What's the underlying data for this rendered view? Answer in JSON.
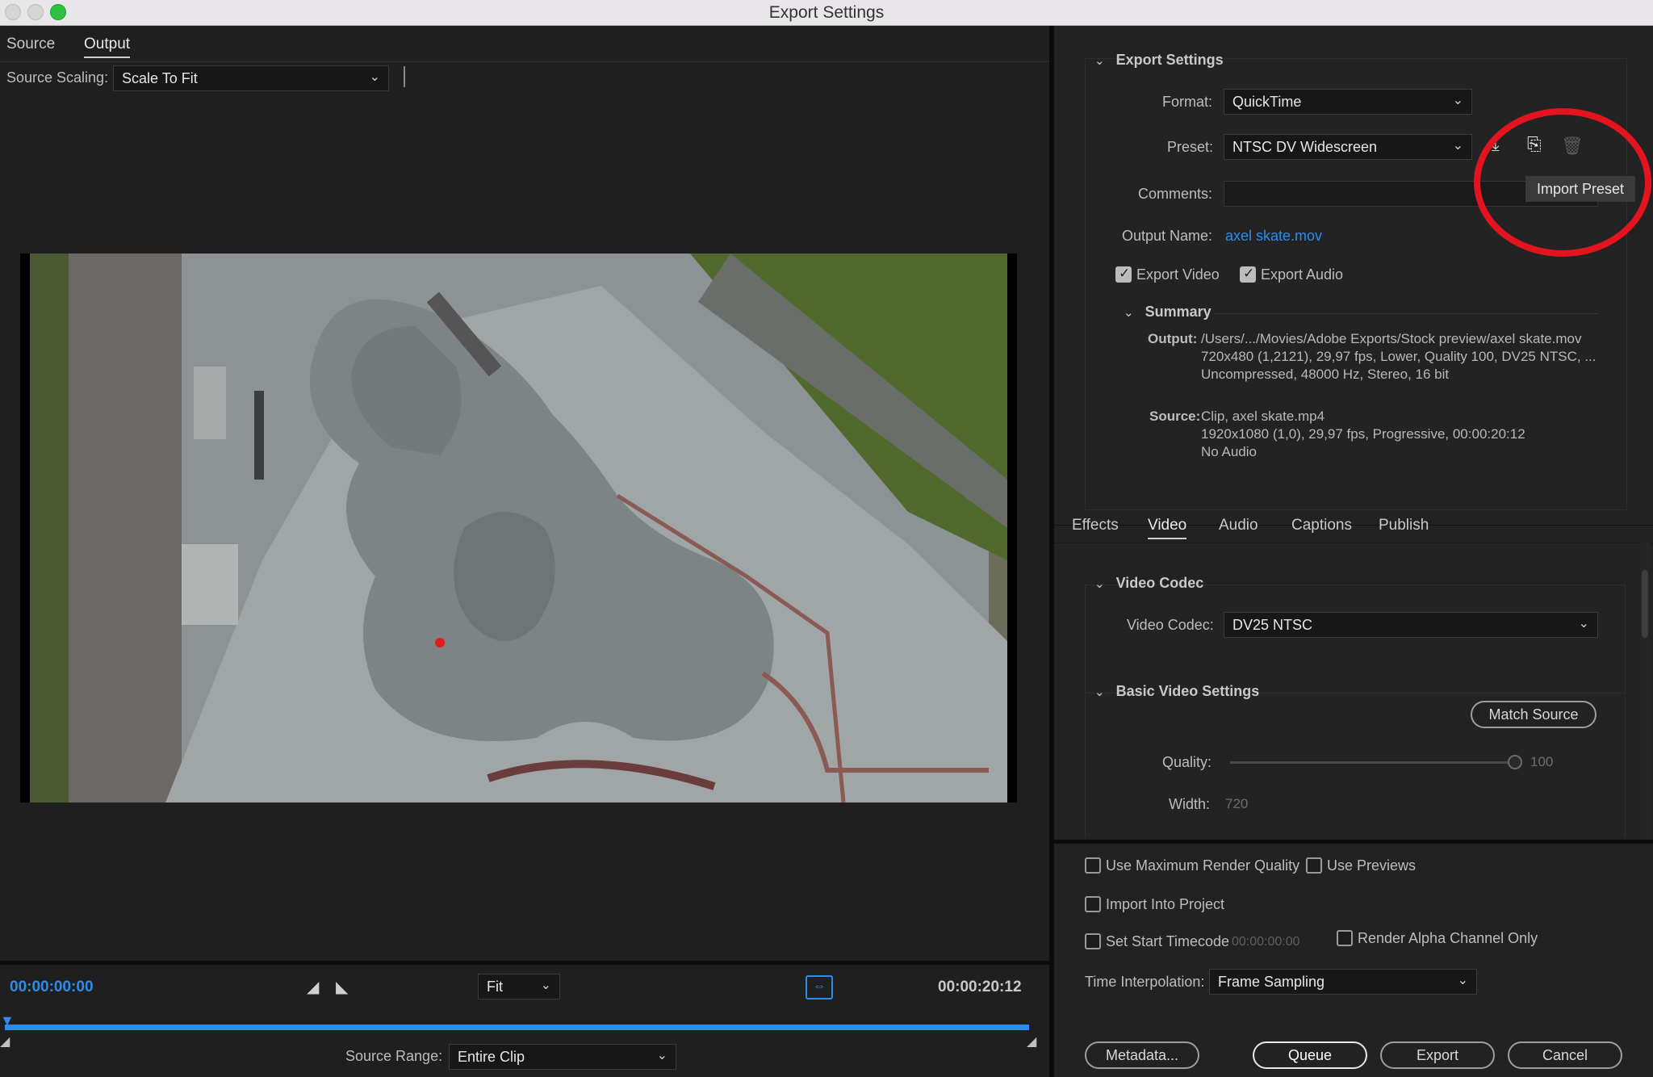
{
  "window": {
    "title": "Export Settings"
  },
  "colors": {
    "accent": "#2d8ceb",
    "panel": "#1f1f1f",
    "highlight": "#e3141e"
  },
  "left_panel": {
    "tabs": [
      "Source",
      "Output"
    ],
    "active_tab": "Output",
    "source_scaling_label": "Source Scaling:",
    "source_scaling_value": "Scale To Fit",
    "timeline": {
      "current_time": "00:00:00:00",
      "end_time": "00:00:20:12",
      "zoom": "Fit",
      "source_range_label": "Source Range:",
      "source_range_value": "Entire Clip"
    }
  },
  "export_settings": {
    "header": "Export Settings",
    "format_label": "Format:",
    "format_value": "QuickTime",
    "preset_label": "Preset:",
    "preset_value": "NTSC DV Widescreen",
    "comments_label": "Comments:",
    "output_name_label": "Output Name:",
    "output_name_value": "axel skate.mov",
    "export_video": "Export Video",
    "export_audio": "Export Audio",
    "tooltip": "Import Preset",
    "preset_icons": [
      "save-preset-icon",
      "import-preset-icon",
      "delete-preset-icon"
    ]
  },
  "summary": {
    "header": "Summary",
    "output_label": "Output:",
    "output_lines": [
      "/Users/.../Movies/Adobe Exports/Stock preview/axel skate.mov",
      "720x480 (1,2121), 29,97 fps, Lower, Quality 100, DV25 NTSC, ...",
      "Uncompressed, 48000 Hz, Stereo, 16 bit"
    ],
    "source_label": "Source:",
    "source_lines": [
      "Clip, axel skate.mp4",
      "1920x1080 (1,0), 29,97 fps, Progressive, 00:00:20:12",
      "No Audio"
    ]
  },
  "settings_tabs": {
    "items": [
      "Effects",
      "Video",
      "Audio",
      "Captions",
      "Publish"
    ],
    "active": "Video"
  },
  "video": {
    "codec_header": "Video Codec",
    "codec_label": "Video Codec:",
    "codec_value": "DV25 NTSC",
    "basic_header": "Basic Video Settings",
    "match_source": "Match Source",
    "quality_label": "Quality:",
    "quality_value": "100",
    "width_label": "Width:",
    "width_value": "720"
  },
  "bottom": {
    "max_render": "Use Maximum Render Quality",
    "use_previews": "Use Previews",
    "import_project": "Import Into Project",
    "start_timecode": "Set Start Timecode",
    "start_timecode_value": "00:00:00:00",
    "alpha_only": "Render Alpha Channel Only",
    "time_interp_label": "Time Interpolation:",
    "time_interp_value": "Frame Sampling",
    "buttons": {
      "metadata": "Metadata...",
      "queue": "Queue",
      "export": "Export",
      "cancel": "Cancel"
    }
  }
}
